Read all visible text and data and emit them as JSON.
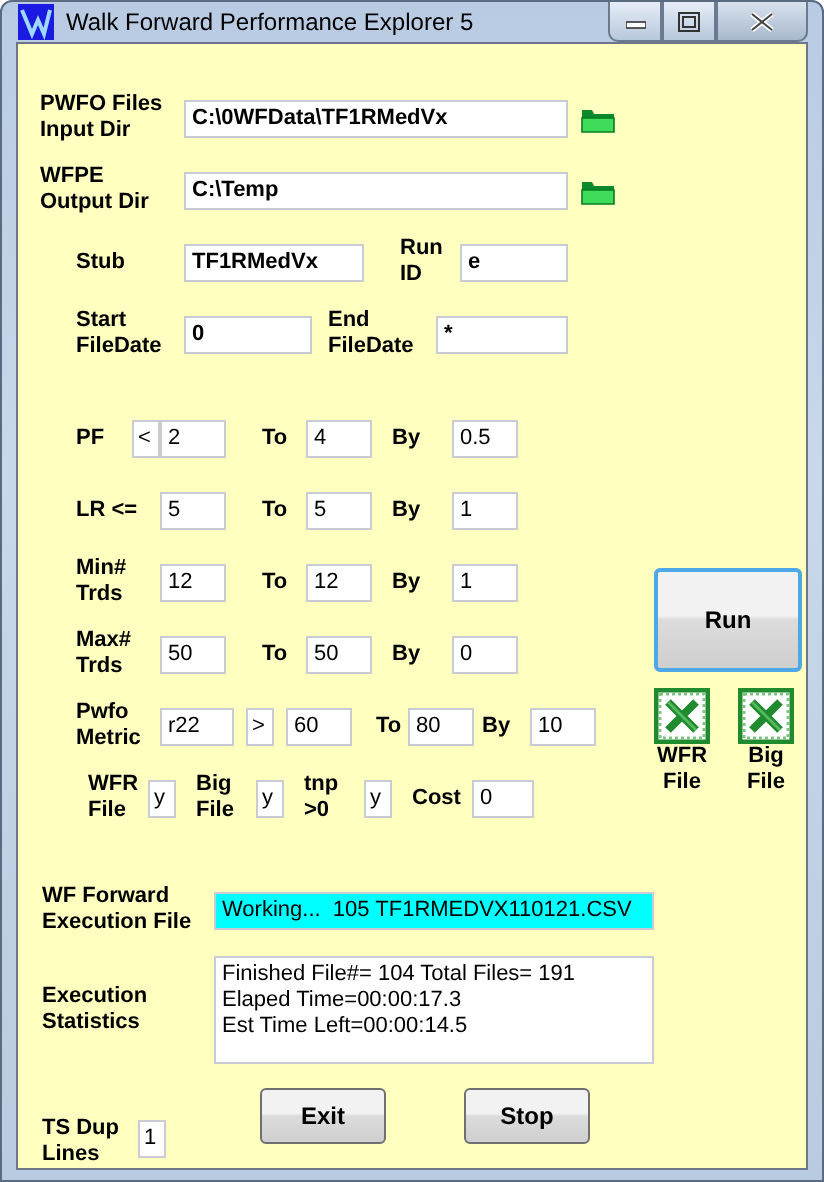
{
  "window": {
    "title": "Walk Forward Performance Explorer 5"
  },
  "dir_fields": [
    {
      "label": "PWFO Files\nInput Dir",
      "value": "C:\\0WFData\\TF1RMedVx"
    },
    {
      "label": "WFPE\nOutput Dir",
      "value": "C:\\Temp"
    }
  ],
  "id_rows": [
    [
      {
        "label": "Stub",
        "value": "TF1RMedVx"
      },
      {
        "label": "Run\nID",
        "value": "e"
      }
    ],
    [
      {
        "label": "Start\nFileDate",
        "value": "0"
      },
      {
        "label": "End\nFileDate",
        "value": "*"
      }
    ]
  ],
  "params": [
    {
      "label": "PF",
      "operator": "<",
      "from": "2",
      "to_label": "To",
      "to": "4",
      "by_label": "By",
      "by": "0.5"
    },
    {
      "label": "LR <=",
      "from": "5",
      "to_label": "To",
      "to": "5",
      "by_label": "By",
      "by": "1"
    },
    {
      "label": "Min#\nTrds",
      "from": "12",
      "to_label": "To",
      "to": "12",
      "by_label": "By",
      "by": "1"
    },
    {
      "label": "Max#\nTrds",
      "from": "50",
      "to_label": "To",
      "to": "50",
      "by_label": "By",
      "by": "0"
    },
    {
      "label": "Pwfo\nMetric",
      "metric": "r22",
      "operator": ">",
      "from": "60",
      "to_label": "To",
      "to": "80",
      "by_label": "By",
      "by": "10"
    }
  ],
  "flags": [
    {
      "label": "WFR\nFile",
      "value": "y"
    },
    {
      "label": "Big\nFile",
      "value": "y"
    },
    {
      "label": "tnp\n>0",
      "value": "y"
    },
    {
      "label": "Cost",
      "value": "0"
    }
  ],
  "run_button": "Run",
  "file_icons": [
    {
      "label": "WFR\nFile"
    },
    {
      "label": "Big\nFile"
    }
  ],
  "execution_file": {
    "label": "WF Forward\nExecution File",
    "value": "Working...  105 TF1RMEDVX110121.CSV"
  },
  "statistics": {
    "label": "Execution\nStatistics",
    "lines": [
      "Finished File#= 104 Total Files= 191",
      "Elaped Time=00:00:17.3",
      "Est Time Left=00:00:14.5"
    ]
  },
  "dup_lines": {
    "label": "TS Dup\nLines",
    "value": "1"
  },
  "buttons": [
    "Exit",
    "Stop"
  ]
}
